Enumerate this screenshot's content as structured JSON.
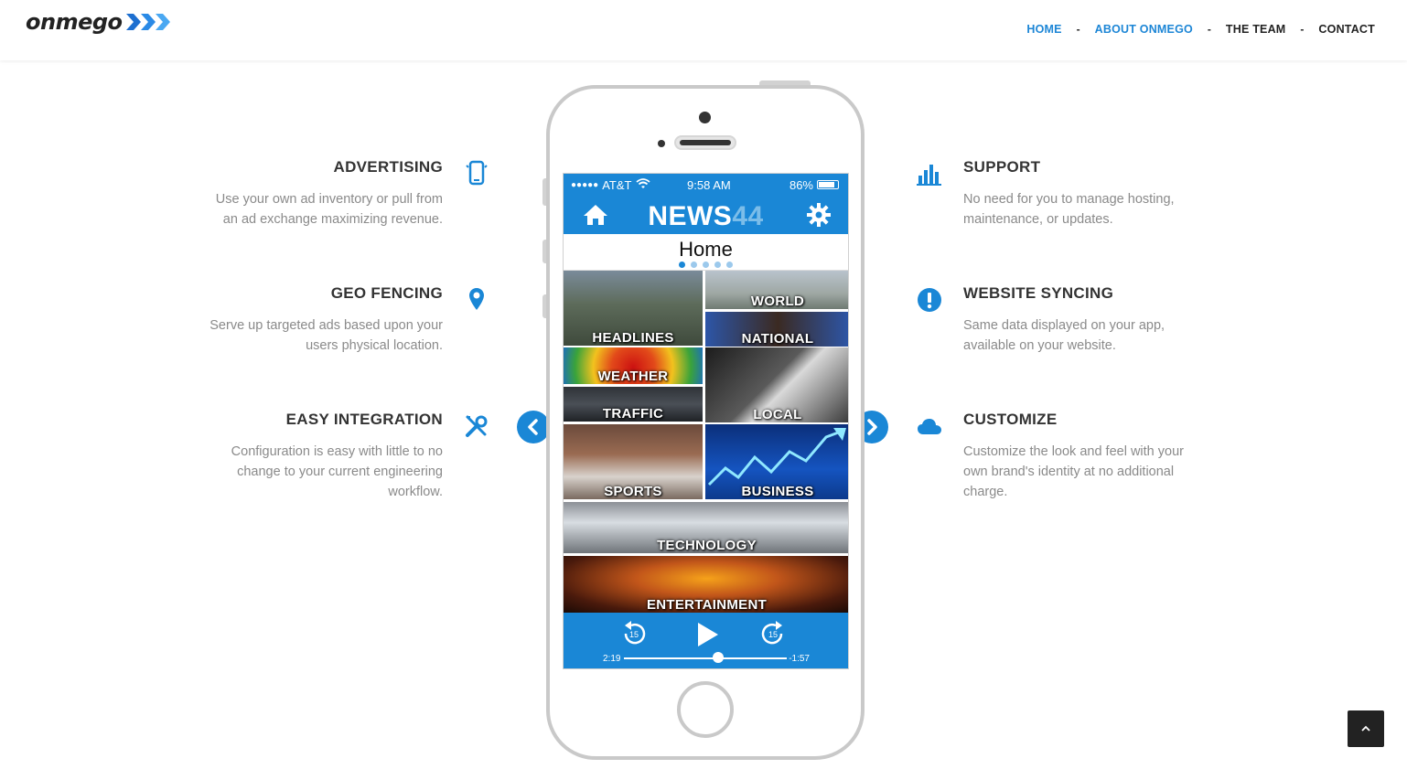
{
  "brand": {
    "logo_text": "onmego"
  },
  "nav": {
    "items": [
      {
        "label": "HOME",
        "active": true
      },
      {
        "label": "ABOUT ONMEGO",
        "active": true
      },
      {
        "label": "THE TEAM",
        "active": false
      },
      {
        "label": "CONTACT",
        "active": false
      }
    ],
    "separator": "-"
  },
  "features_left": [
    {
      "title": "ADVERTISING",
      "text_line1": "Use your own ad inventory or pull from",
      "text_line2": "an ad exchange maximizing revenue.",
      "text_line3": "",
      "icon": "mobile-icon"
    },
    {
      "title": "GEO FENCING",
      "text_line1": "Serve up targeted ads based upon your",
      "text_line2": "users physical location.",
      "text_line3": "",
      "icon": "map-pin-icon"
    },
    {
      "title": "EASY INTEGRATION",
      "text_line1": "Configuration is easy with little to no",
      "text_line2": "change to your current engineering",
      "text_line3": "workflow.",
      "icon": "wrench-icon"
    }
  ],
  "features_right": [
    {
      "title": "SUPPORT",
      "text_line1": "No need for you to manage hosting,",
      "text_line2": "maintenance, or updates.",
      "text_line3": "",
      "icon": "bar-chart-icon"
    },
    {
      "title": "WEBSITE SYNCING",
      "text_line1": "Same data displayed on your app,",
      "text_line2": "available on your website.",
      "text_line3": "",
      "icon": "exclamation-icon"
    },
    {
      "title": "CUSTOMIZE",
      "text_line1": "Customize the look and feel with your",
      "text_line2": "own brand's identity at no additional",
      "text_line3": "charge.",
      "icon": "cloud-icon"
    }
  ],
  "phone": {
    "status": {
      "dots": "●●●●●",
      "carrier": "AT&T",
      "time": "9:58 AM",
      "battery": "86%"
    },
    "app_title_main": "NEWS",
    "app_title_num": "44",
    "page_label": "Home",
    "tiles": {
      "headlines": "HEADLINES",
      "world": "WORLD",
      "national": "NATIONAL",
      "weather": "WEATHER",
      "traffic": "TRAFFIC",
      "local": "LOCAL",
      "sports": "SPORTS",
      "business": "BUSINESS",
      "technology": "TECHNOLOGY",
      "entertainment": "ENTERTAINMENT"
    },
    "player": {
      "elapsed": "2:19",
      "remaining": "-1:57",
      "skip_back": "15",
      "skip_fwd": "15",
      "progress": 0.58
    }
  },
  "colors": {
    "accent": "#1a87d6",
    "text_dark": "#333333",
    "text_muted": "#8a8a8a"
  }
}
